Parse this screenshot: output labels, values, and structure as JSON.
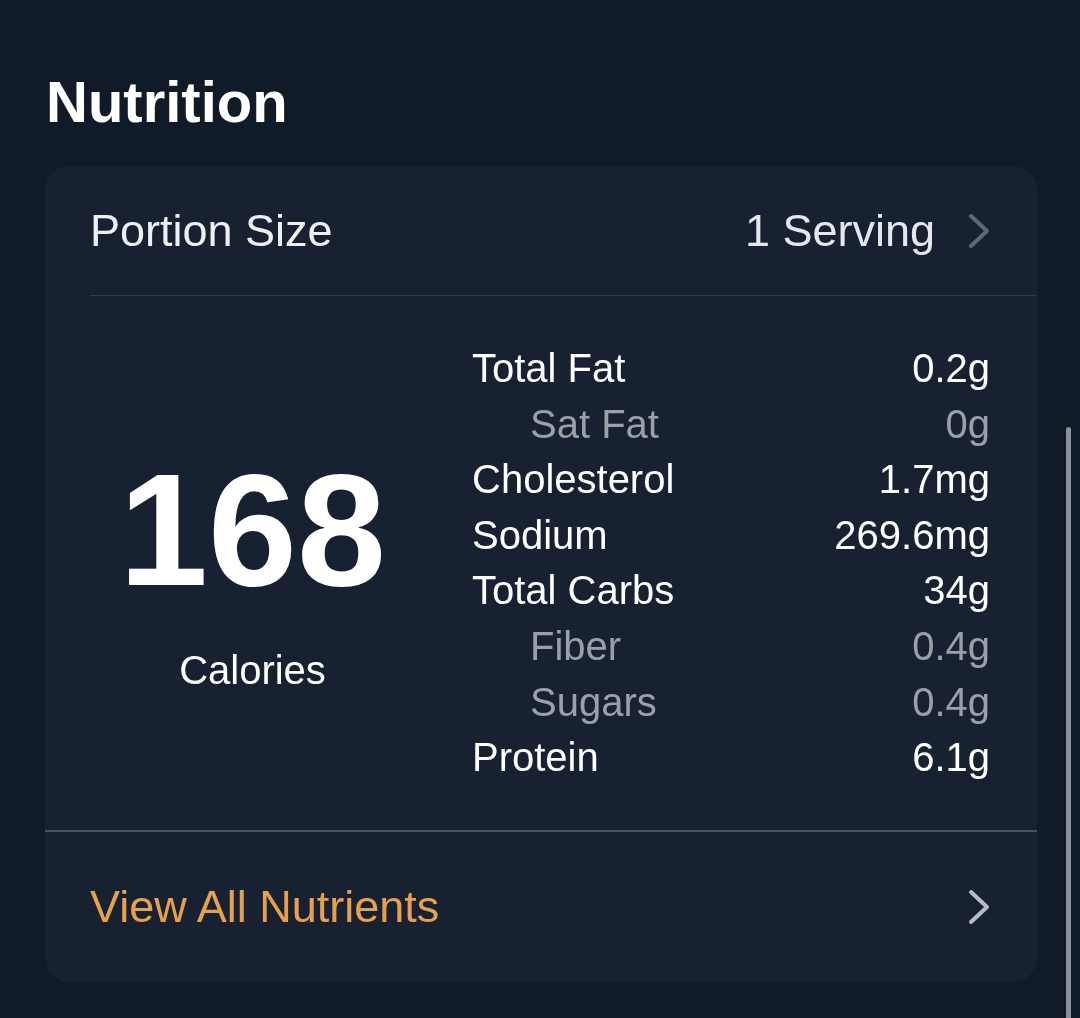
{
  "title": "Nutrition",
  "portion": {
    "label": "Portion Size",
    "value": "1 Serving"
  },
  "calories": {
    "value": "168",
    "label": "Calories"
  },
  "nutrients": [
    {
      "name": "Total Fat",
      "amount": "0.2g",
      "kind": "main"
    },
    {
      "name": "Sat Fat",
      "amount": "0g",
      "kind": "sub"
    },
    {
      "name": "Cholesterol",
      "amount": "1.7mg",
      "kind": "main"
    },
    {
      "name": "Sodium",
      "amount": "269.6mg",
      "kind": "main"
    },
    {
      "name": "Total Carbs",
      "amount": "34g",
      "kind": "main"
    },
    {
      "name": "Fiber",
      "amount": "0.4g",
      "kind": "sub"
    },
    {
      "name": "Sugars",
      "amount": "0.4g",
      "kind": "sub"
    },
    {
      "name": "Protein",
      "amount": "6.1g",
      "kind": "main"
    }
  ],
  "footer_link": {
    "label": "View All Nutrients"
  }
}
